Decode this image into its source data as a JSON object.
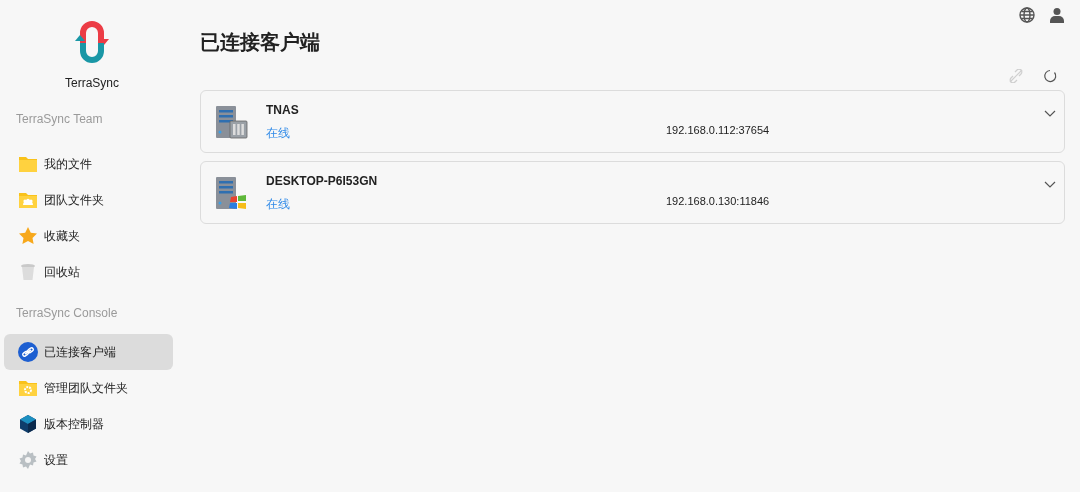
{
  "sidebar": {
    "logo_text": "TerraSync",
    "sections": [
      {
        "title": "TerraSync Team",
        "items": [
          {
            "label": "我的文件",
            "kind": "folder",
            "selected": false
          },
          {
            "label": "团队文件夹",
            "kind": "team-folder",
            "selected": false
          },
          {
            "label": "收藏夹",
            "kind": "star",
            "selected": false
          },
          {
            "label": "回收站",
            "kind": "trash",
            "selected": false
          }
        ]
      },
      {
        "title": "TerraSync Console",
        "items": [
          {
            "label": "已连接客户端",
            "kind": "link",
            "selected": true
          },
          {
            "label": "管理团队文件夹",
            "kind": "manage-folder",
            "selected": false
          },
          {
            "label": "版本控制器",
            "kind": "cube",
            "selected": false
          },
          {
            "label": "设置",
            "kind": "gear",
            "selected": false
          }
        ]
      }
    ]
  },
  "page": {
    "title": "已连接客户端",
    "toolbar": [
      {
        "kind": "unlink",
        "disabled": true
      },
      {
        "kind": "refresh",
        "disabled": false
      }
    ],
    "clients": [
      {
        "kind": "nas",
        "name": "TNAS",
        "status": "在线",
        "address": "192.168.0.112:37654",
        "expanded": false
      },
      {
        "kind": "windows",
        "name": "DESKTOP-P6I53GN",
        "status": "在线",
        "address": "192.168.0.130:11846",
        "expanded": false
      }
    ]
  }
}
